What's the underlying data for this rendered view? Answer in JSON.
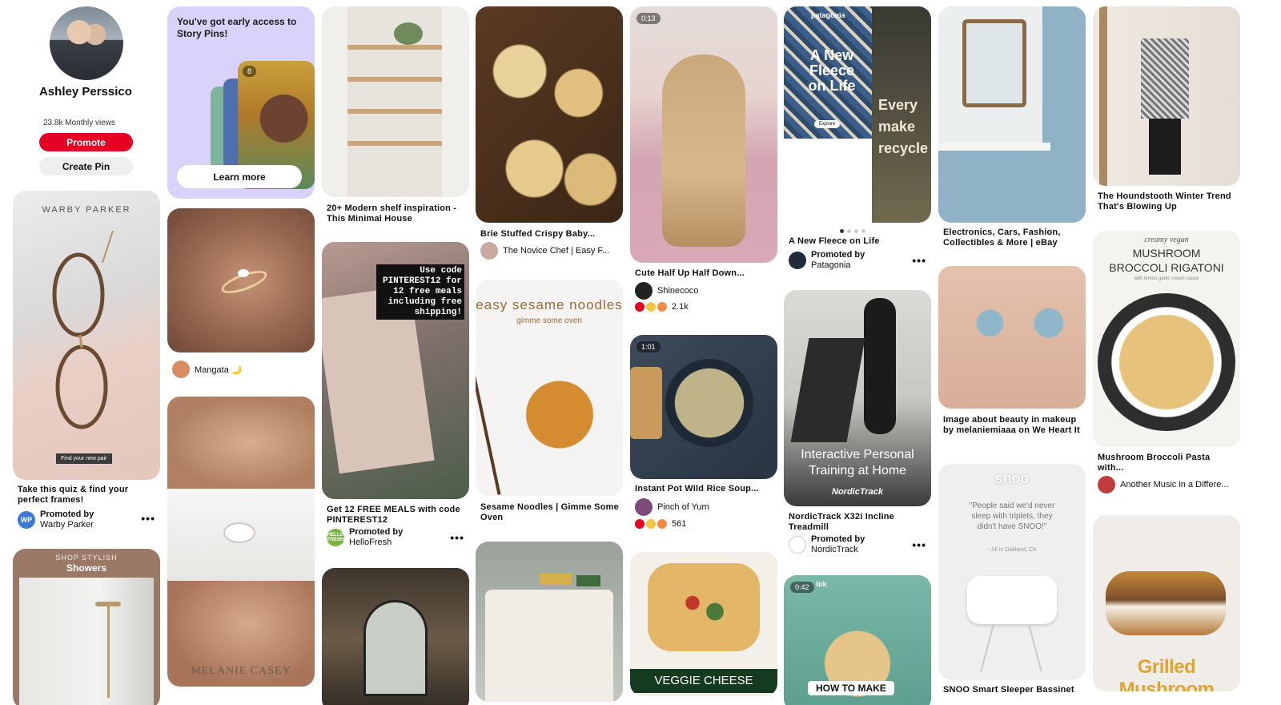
{
  "profile": {
    "name": "Ashley Perssico",
    "views": "23.8k Monthly views",
    "promote_label": "Promote",
    "create_label": "Create Pin"
  },
  "colors": {
    "brand_red": "#e60023",
    "button_grey": "#efefef"
  },
  "pins": {
    "warby": {
      "brand": "WARBY PARKER",
      "cta": "Find your new pair",
      "title": "Take this quiz & find your perfect frames!",
      "promoted": "Promoted by",
      "by": "Warby Parker",
      "avatar": "WP"
    },
    "showers": {
      "line1": "SHOP STYLISH",
      "line2": "Showers"
    },
    "story": {
      "text": "You've got early access to Story Pins!",
      "button": "Learn more",
      "badge": "8"
    },
    "ring1": {
      "user": "Mangata 🌙"
    },
    "ring2": {
      "brand": "MELANIE CASEY"
    },
    "shelf": {
      "title": "20+ Modern shelf inspiration - This Minimal House"
    },
    "hello": {
      "overlay": "Use code PINTEREST12 for 12 free meals including free shipping!",
      "title": "Get 12 FREE MEALS with code PINTEREST12",
      "promoted": "Promoted by",
      "by": "HelloFresh",
      "avatar": "HELLO FRESH"
    },
    "brie": {
      "title": "Brie Stuffed Crispy Baby...",
      "user": "The Novice Chef | Easy F..."
    },
    "sesame": {
      "line1": "easy sesame noodles",
      "line2": "gimme some oven",
      "title": "Sesame Noodles | Gimme Some Oven"
    },
    "hair": {
      "badge": "0:13",
      "title": "Cute Half Up Half Down...",
      "user": "Shinecoco",
      "count": "2.1k"
    },
    "soup": {
      "badge": "1:01",
      "title": "Instant Pot Wild Rice Soup...",
      "user": "Pinch of Yum",
      "count": "561"
    },
    "stromboli": {
      "text": "VEGGIE CHEESE STROMBOLI"
    },
    "patagonia": {
      "brand": "patagonia",
      "headline": "A New Fleece on Life",
      "explore": "Explore",
      "side": "Every make recycle",
      "title": "A New Fleece on Life",
      "promoted": "Promoted by",
      "by": "Patagonia"
    },
    "nordic": {
      "line1": "Interactive Personal",
      "line2": "Training at Home",
      "logo": "NordicTrack",
      "title": "NordicTrack X32i Incline Treadmill",
      "promoted": "Promoted by",
      "by": "NordicTrack"
    },
    "chickpea": {
      "badge": "0:42",
      "user": "tok",
      "caption": "HOW TO MAKE"
    },
    "ebay": {
      "title": "Electronics, Cars, Fashion, Collectibles & More | eBay"
    },
    "makeup": {
      "title": "Image about beauty in makeup by melaniemiaaa on We Heart It"
    },
    "snoo": {
      "logo": "snoo",
      "quote": "\"People said we'd never sleep with triplets, they didn't have SNOO!\"",
      "attr": "- Jill in Oakland, CA",
      "caption": "SNOO Smart Sleeper Bassinet"
    },
    "houndstooth": {
      "title": "The Houndstooth Winter Trend That's Blowing Up"
    },
    "rigatoni": {
      "line1": "creamy vegan",
      "line2": "MUSHROOM",
      "line3": "BROCCOLI RIGATONI",
      "line4": "with lemon garlic cream sauce",
      "title": "Mushroom Broccoli Pasta with...",
      "user": "Another Music in a Differe..."
    },
    "grilled": {
      "text": "Grilled Mushroom"
    }
  }
}
